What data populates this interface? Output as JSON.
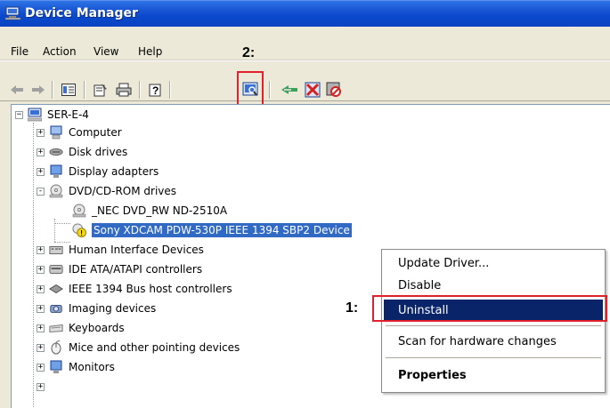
{
  "window": {
    "title": "Device Manager"
  },
  "menu": {
    "items": [
      "File",
      "Action",
      "View",
      "Help"
    ],
    "annotation": "2:"
  },
  "toolbar": {
    "buttons": [
      "back-arrow",
      "forward-arrow",
      "show-hide-console-tree",
      "properties",
      "print",
      "help",
      "scan-hardware-changes",
      "update-driver",
      "uninstall",
      "disable"
    ]
  },
  "tree": {
    "root": "SER-E-4",
    "items": [
      {
        "label": "Computer",
        "expander": "+"
      },
      {
        "label": "Disk drives",
        "expander": "+"
      },
      {
        "label": "Display adapters",
        "expander": "+"
      },
      {
        "label": "DVD/CD-ROM drives",
        "expander": "-"
      },
      {
        "label": "_NEC DVD_RW ND-2510A",
        "expander": ""
      },
      {
        "label": "Sony XDCAM PDW-530P IEEE 1394 SBP2 Device",
        "expander": "",
        "selected": true
      },
      {
        "label": "Human Interface Devices",
        "expander": "+"
      },
      {
        "label": "IDE ATA/ATAPI controllers",
        "expander": "+"
      },
      {
        "label": "IEEE 1394 Bus host controllers",
        "expander": "+"
      },
      {
        "label": "Imaging devices",
        "expander": "+"
      },
      {
        "label": "Keyboards",
        "expander": "+"
      },
      {
        "label": "Mice and other pointing devices",
        "expander": "+"
      },
      {
        "label": "Monitors",
        "expander": "+"
      }
    ]
  },
  "context_menu": {
    "items": [
      "Update Driver...",
      "Disable",
      "Uninstall",
      "Scan for hardware changes",
      "Properties"
    ],
    "annotation": "1:"
  },
  "colors": {
    "selection": "#316ac5",
    "menu_active": "#0a246a",
    "highlight_box": "#e0202a",
    "titlebar": "#0a48cc"
  }
}
